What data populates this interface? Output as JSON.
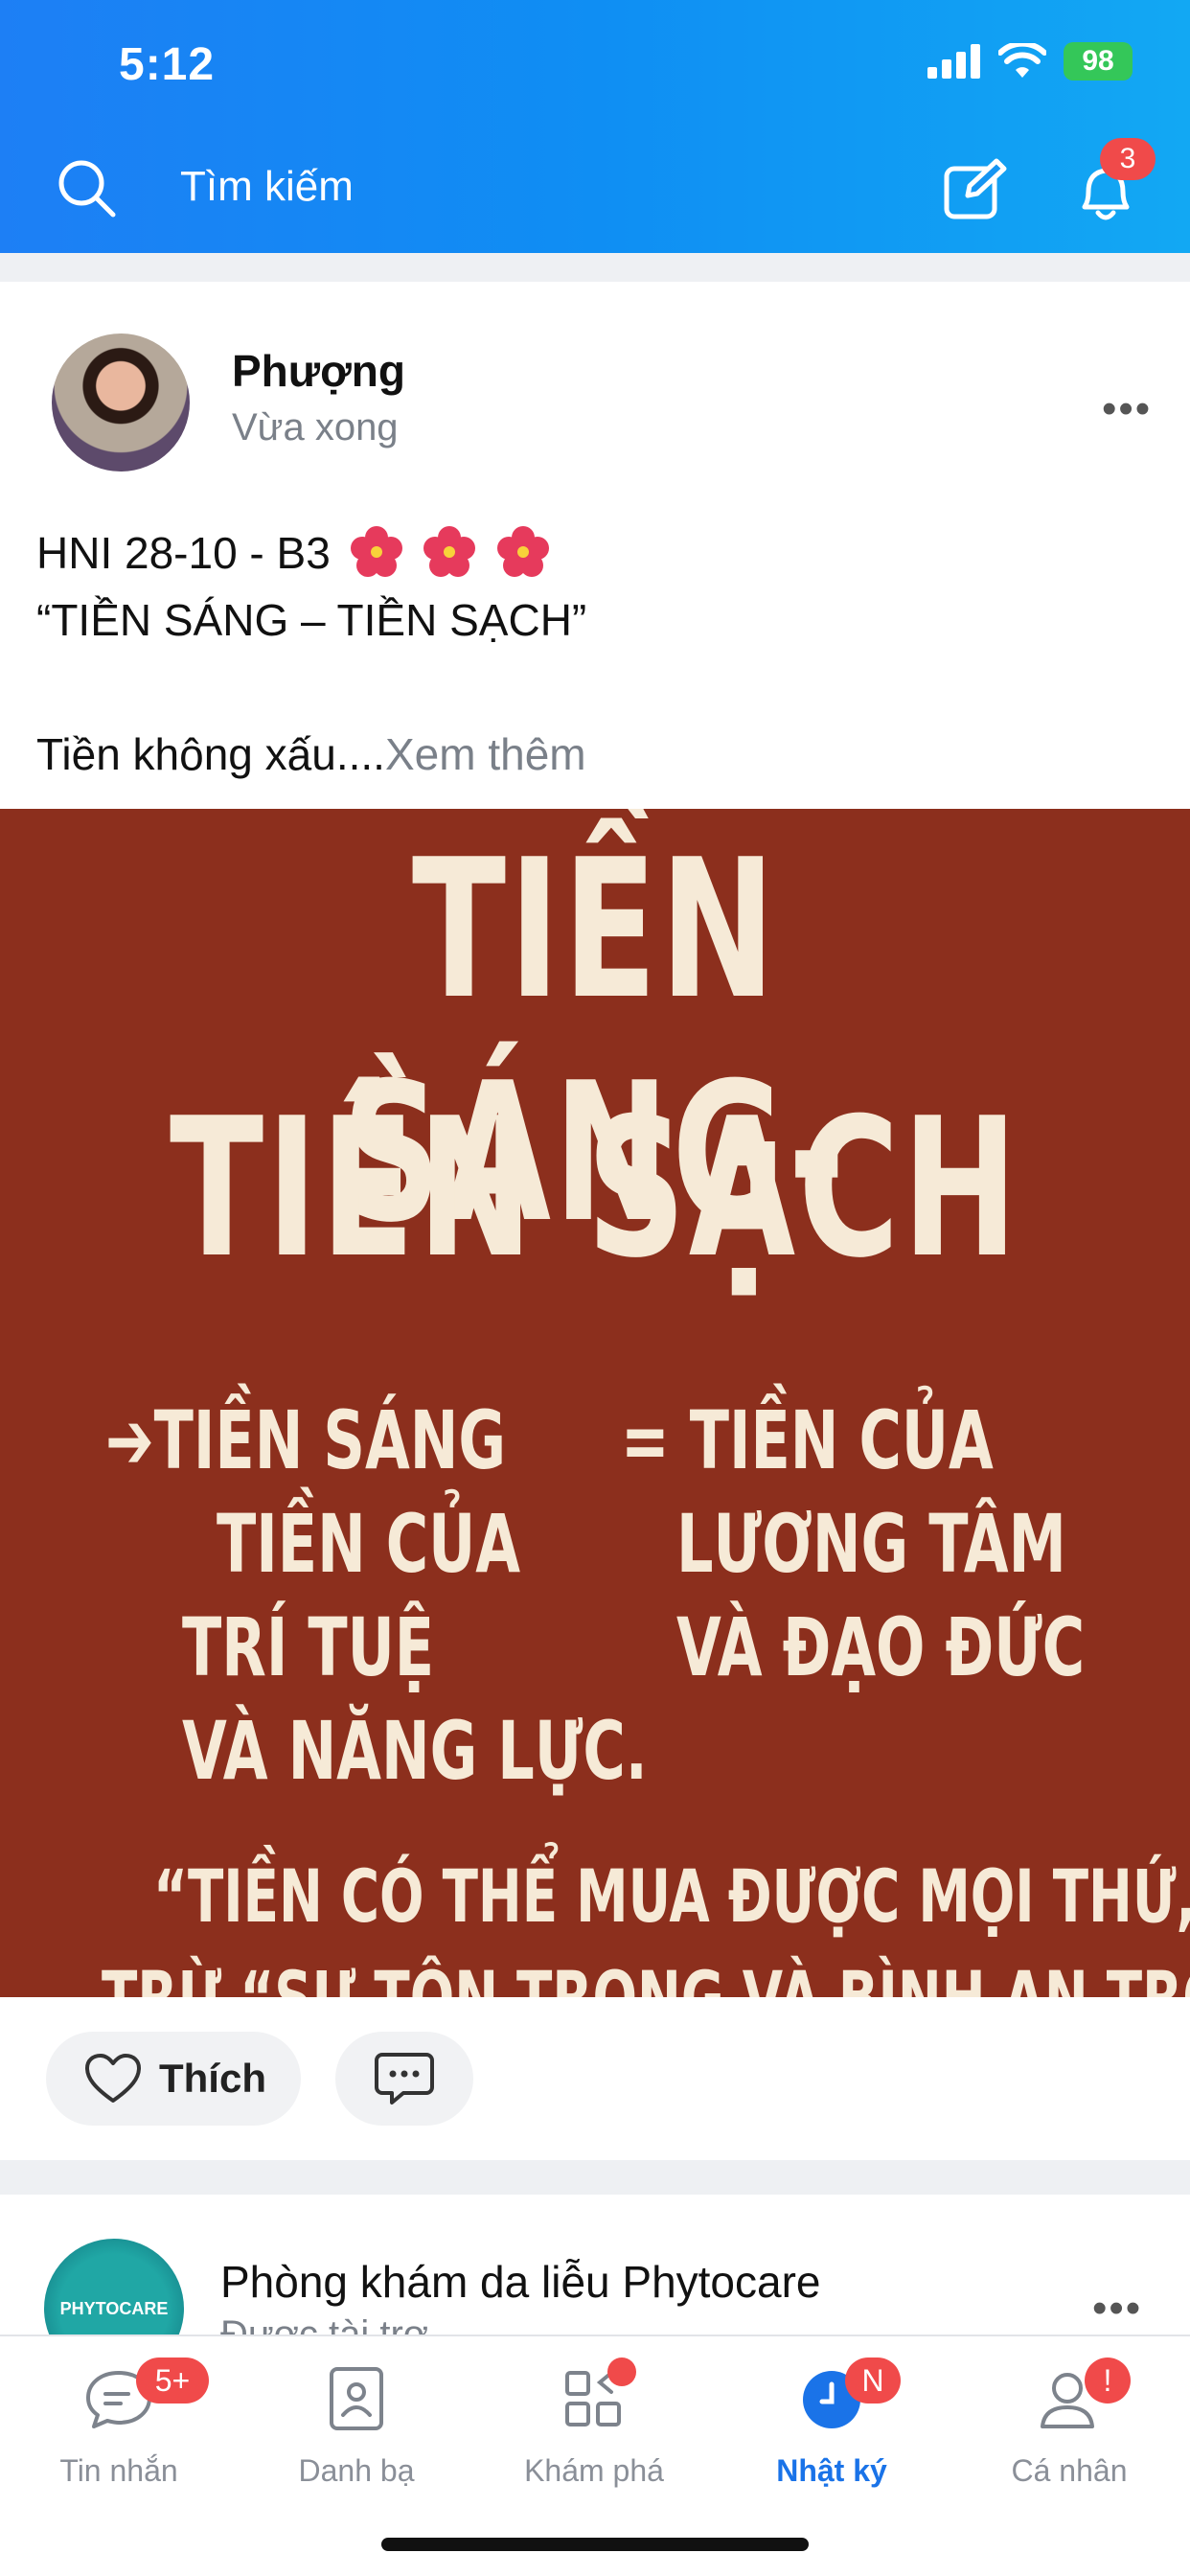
{
  "status_bar": {
    "time": "5:12",
    "battery": "98"
  },
  "header": {
    "search_placeholder": "Tìm kiếm",
    "notification_count": "3",
    "icons": [
      "search-icon",
      "compose-icon",
      "bell-icon"
    ]
  },
  "post": {
    "author": "Phượng",
    "time": "Vừa xong",
    "text_line1": "HNI 28-10 - B3",
    "text_line2": "“TIỀN SÁNG – TIỀN SẠCH”",
    "text_line3": "Tiền không xấu....",
    "see_more": "Xem thêm",
    "image": {
      "title1": "TIỀN SÁNG-",
      "title2": "TIỀN SẠCH",
      "left_col": [
        "➔TIỀN SÁNG",
        "TIỀN CỦA",
        "TRÍ TUỆ",
        "VÀ NĂNG LỰC."
      ],
      "right_col": [
        "= TIỀN CỦA",
        "LƯƠNG TÂM",
        "VÀ ĐẠO ĐỨC"
      ],
      "quote1": "“TIỀN CÓ THỂ MUA ĐƯỢC MỌI THỨ,",
      "quote2": "TRỪ “SỰ TÔN TRỌNG VÀ BÌNH AN TRONG"
    },
    "like_label": "Thích"
  },
  "post2": {
    "author": "Phòng khám da liễu Phytocare",
    "sponsored": "Được tài trợ",
    "avatar_text": "PHYTOCARE"
  },
  "bottom_nav": {
    "items": [
      {
        "label": "Tin nhắn",
        "badge": "5+"
      },
      {
        "label": "Danh bạ"
      },
      {
        "label": "Khám phá"
      },
      {
        "label": "Nhật ký",
        "badge": "N"
      },
      {
        "label": "Cá nhân",
        "badge": "!"
      }
    ],
    "active_index": 3
  },
  "colors": {
    "brand": "#1d7ff5",
    "badge": "#f04a4a",
    "image_bg": "#8c2f1d",
    "active": "#1a73e8"
  }
}
